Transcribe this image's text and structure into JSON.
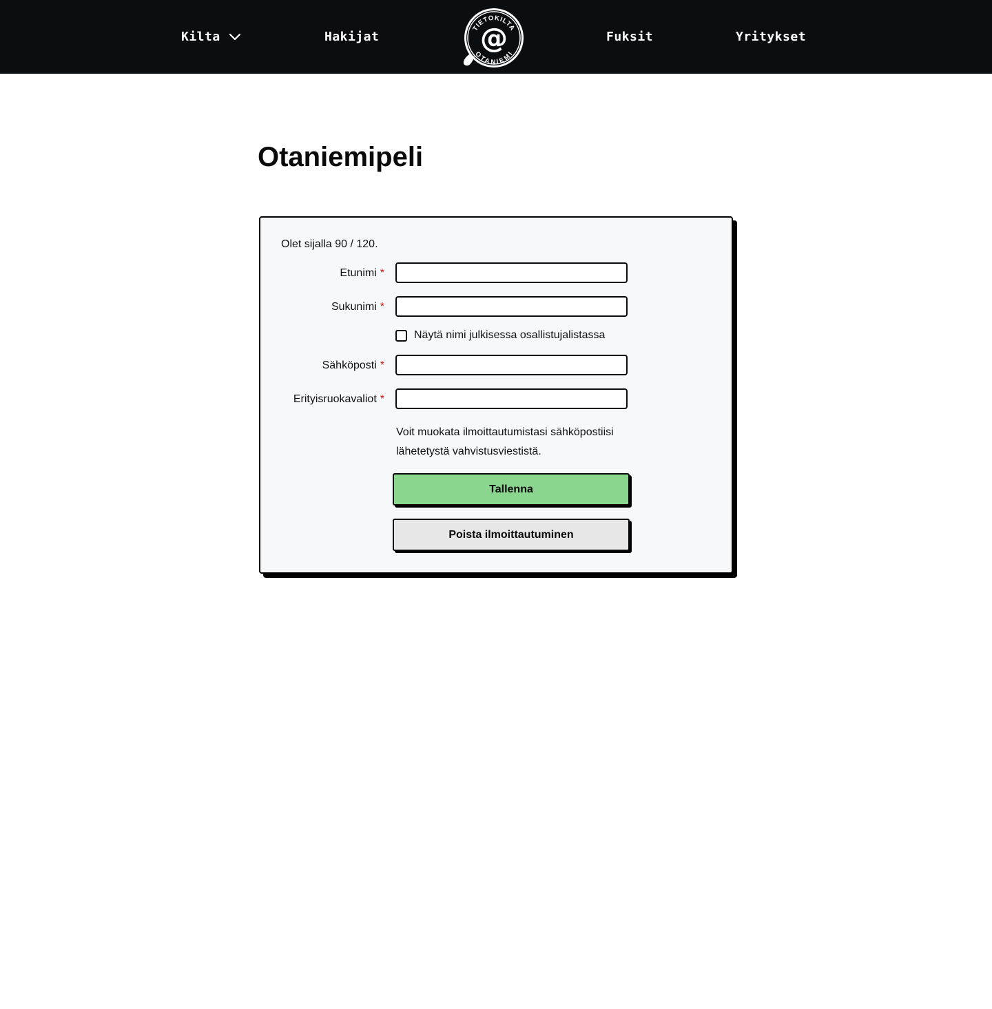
{
  "nav": {
    "items": [
      {
        "label": "Kilta",
        "has_dropdown": true
      },
      {
        "label": "Hakijat"
      },
      {
        "label": "Fuksit"
      },
      {
        "label": "Yritykset"
      }
    ],
    "logo": {
      "top_text": "TIETOKILTA",
      "bottom_text": "OTANIEMI",
      "center_glyph": "@"
    }
  },
  "page": {
    "title": "Otaniemipeli"
  },
  "form": {
    "queue_status": "Olet sijalla 90 / 120.",
    "required_marker": "*",
    "fields": {
      "first_name": {
        "label": "Etunimi",
        "value": "",
        "placeholder": ""
      },
      "last_name": {
        "label": "Sukunimi",
        "value": "",
        "placeholder": ""
      },
      "email": {
        "label": "Sähköposti",
        "value": "",
        "placeholder": ""
      },
      "diet": {
        "label": "Erityisruokavaliot",
        "value": "",
        "placeholder": ""
      }
    },
    "public_name_checkbox": {
      "label": "Näytä nimi julkisessa osallistujalistassa",
      "checked": false
    },
    "info_text": "Voit muokata ilmoittautumistasi sähköpostiisi lähetetystä vahvistusviestistä.",
    "save_label": "Tallenna",
    "delete_label": "Poista ilmoittautuminen"
  },
  "colors": {
    "header_bg": "#0a0e11",
    "card_bg": "#f7f8fa",
    "save_button": "#8ad68e",
    "delete_button": "#e7e7e7",
    "required": "#d11a1a"
  }
}
